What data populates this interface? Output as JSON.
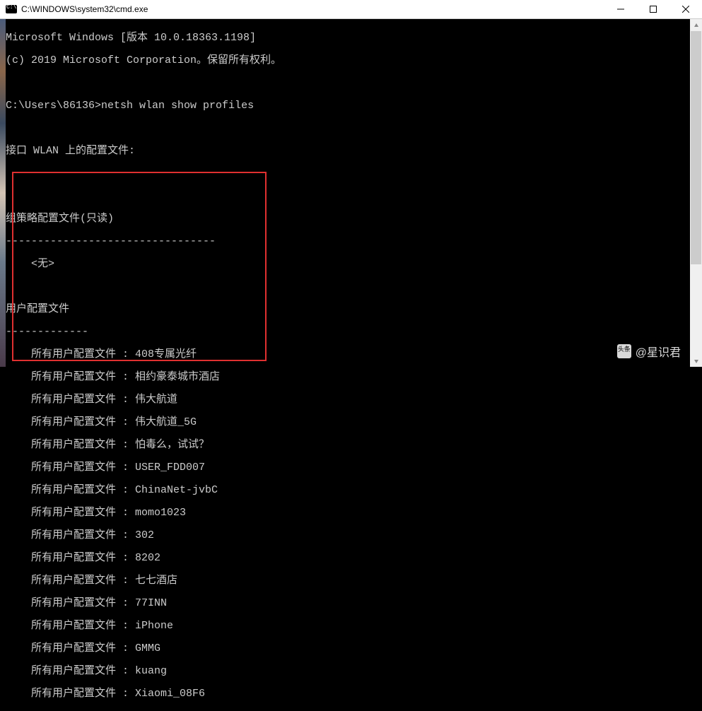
{
  "window": {
    "title": "C:\\WINDOWS\\system32\\cmd.exe",
    "minimize": "—",
    "maximize": "☐",
    "close": "✕"
  },
  "terminal": {
    "header1": "Microsoft Windows [版本 10.0.18363.1198]",
    "header2": "(c) 2019 Microsoft Corporation。保留所有权利。",
    "blank": "",
    "prompt_prefix": "C:\\Users\\86136>",
    "command": "netsh wlan show profiles",
    "interface_line": "接口 WLAN 上的配置文件:",
    "gp_header": "组策略配置文件(只读)",
    "gp_divider": "---------------------------------",
    "gp_none": "    <无>",
    "user_header": "用户配置文件",
    "user_divider": "-------------",
    "profile_label": "    所有用户配置文件 : ",
    "profiles": [
      "408专属光纤",
      "相约豪泰城市酒店",
      "伟大航道",
      "伟大航道_5G",
      "怕毒么，试试？",
      "USER_FDD007",
      "ChinaNet-jvbC",
      "momo1023",
      "302",
      "8202",
      "七七酒店",
      "77INN",
      "iPhone",
      "GMMG",
      "kuang",
      "Xiaomi_08F6"
    ]
  },
  "watermark": {
    "text": "@星识君"
  }
}
